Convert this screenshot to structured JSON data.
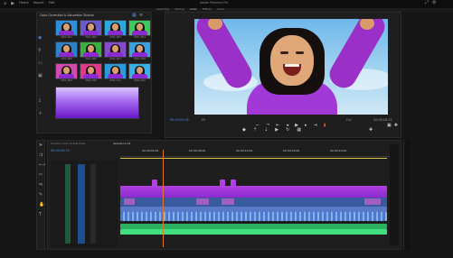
{
  "app": {
    "title": "Adobe Premiere Pro",
    "menu": [
      "File",
      "Edit",
      "Clip",
      "Sequence",
      "Markers",
      "Graphics",
      "View",
      "Window",
      "Help"
    ],
    "top_left_labels": [
      "Home",
      "Import",
      "Edit",
      "Export"
    ],
    "workspace_tabs": [
      "Assembly",
      "Editing",
      "Color",
      "Effects",
      "Audio"
    ],
    "top_right": "⌂ ⤢"
  },
  "project_panel": {
    "title": "Color Correction & Saturation Tutorial",
    "clip_label": "VSCL.001",
    "thumbnails": [
      {
        "bg": "#2d8fd8",
        "label": "VSCL.001"
      },
      {
        "bg": "#6a5acd",
        "label": "VSCL.002"
      },
      {
        "bg": "#2aa8e0",
        "label": "VSCL.003"
      },
      {
        "bg": "#3cc85a",
        "label": "VSCL.004"
      },
      {
        "bg": "#2b82c8",
        "label": "VSCL.005"
      },
      {
        "bg": "#38b040",
        "label": "VSCL.006"
      },
      {
        "bg": "#8a4ad0",
        "label": "VSCL.007"
      },
      {
        "bg": "#3aa0e0",
        "label": "VSCL.008"
      },
      {
        "bg": "#d04ab0",
        "label": "VSCL.009"
      },
      {
        "bg": "#e23a8a",
        "label": "VSCL.010"
      },
      {
        "bg": "#2a9ae0",
        "label": "VSCL.011"
      },
      {
        "bg": "#3ab0e8",
        "label": "VSCL.012"
      }
    ]
  },
  "program_monitor": {
    "timecode_in": "00:00:05:08",
    "timecode_out": "00:00:28:12",
    "zoom": "Fit",
    "quality": "Full"
  },
  "timeline": {
    "sequence_name": "Sequence 01",
    "source": "Source: Color Grade Final",
    "timecode": "00:00:04:19",
    "ruler_labels": [
      "00:00:00",
      "00:00:04:00",
      "00:00:08:00",
      "00:00:12:00",
      "00:00:16:00",
      "00:00:20:00"
    ],
    "tracks_video": [
      "V3",
      "V2",
      "V1"
    ],
    "tracks_audio": [
      "A1",
      "A2",
      "A3"
    ]
  },
  "colors": {
    "accent": "#2a6fd6",
    "purple": "#9a3ad8",
    "green": "#2ad070",
    "playhead": "#e07a2a"
  }
}
